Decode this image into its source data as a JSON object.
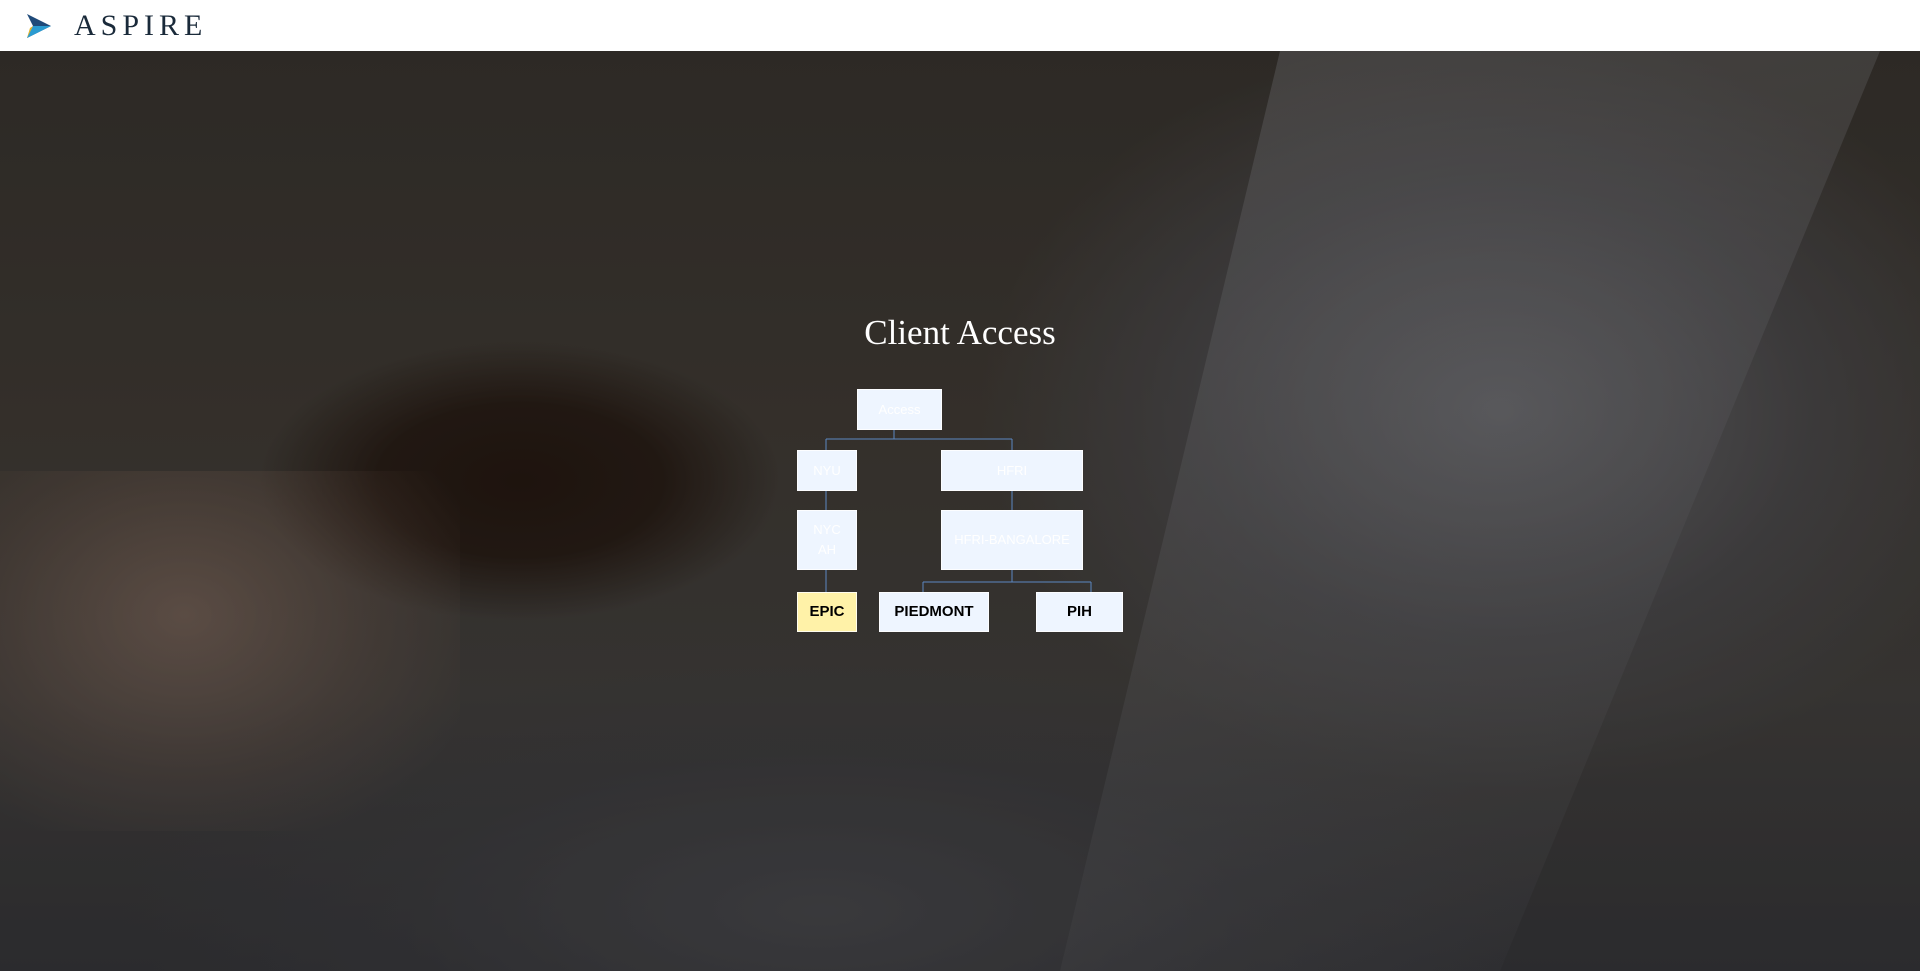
{
  "header": {
    "brand": "ASPIRE",
    "logo_icon": "play-triangle-icon"
  },
  "page": {
    "title": "Client Access"
  },
  "tree": {
    "root": "Access",
    "nyu": "NYU",
    "nyc_ah": "NYC AH",
    "hfri": "HFRI",
    "hfri_bangalore": "HFRI-BANGALORE",
    "epic": "EPIC",
    "piedmont": "PIEDMONT",
    "pih": "PIH"
  },
  "colors": {
    "node_bg": "#eef5ff",
    "selected_bg": "#fff2a8",
    "connector": "#5b88c2"
  }
}
